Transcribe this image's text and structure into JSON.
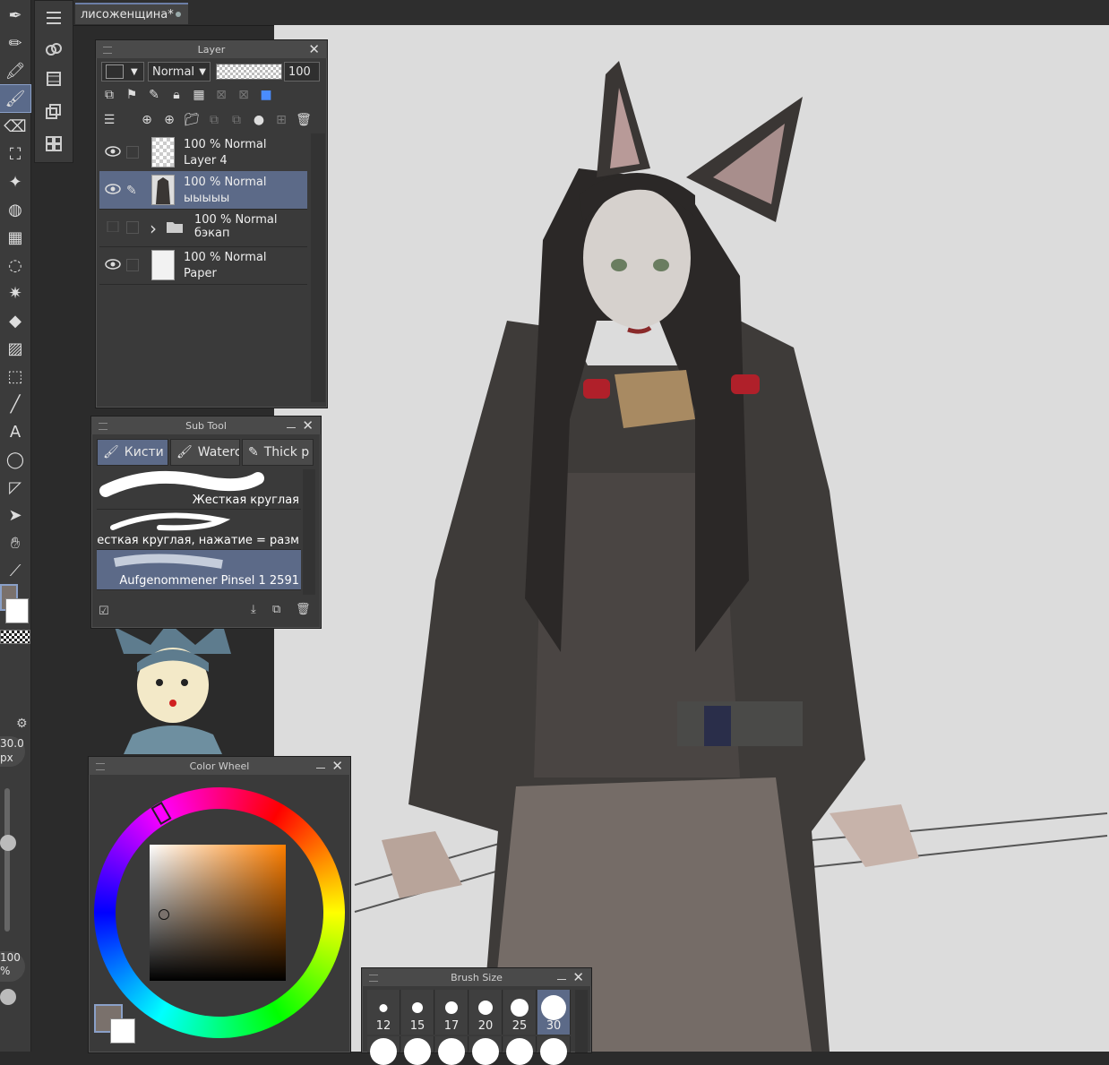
{
  "document": {
    "tab_title": "лисоженщина*"
  },
  "tools": {
    "active_index": 3,
    "size_value": "30.0",
    "size_unit": "px",
    "opacity_value": "100",
    "opacity_unit": "%",
    "icons": [
      "pen-icon",
      "pencil-icon",
      "marker-icon",
      "brush-icon",
      "eraser-icon",
      "stamp-icon",
      "sparkle-icon",
      "blend-icon",
      "mesh-icon",
      "lasso-icon",
      "star-icon",
      "fill-icon",
      "gradient-icon",
      "3d-icon",
      "line-icon",
      "text-icon",
      "select-icon",
      "figure-icon",
      "move-icon",
      "hand-icon",
      "eyedropper-icon"
    ]
  },
  "layer_panel": {
    "title": "Layer",
    "blend_mode": "Normal",
    "opacity": "100",
    "layers": [
      {
        "percent": "100 %",
        "mode": "Normal",
        "name": "Layer 4",
        "visible": true,
        "thumb": "checker"
      },
      {
        "percent": "100 %",
        "mode": "Normal",
        "name": "ыыыыы",
        "visible": true,
        "selected": true,
        "thumb": "figure"
      },
      {
        "percent": "100 %",
        "mode": "Normal",
        "name": "бэкап",
        "visible": false,
        "folder": true
      },
      {
        "percent": "100 %",
        "mode": "Normal",
        "name": "Paper",
        "visible": true,
        "thumb": "paper"
      }
    ]
  },
  "subtool_panel": {
    "title": "Sub Tool",
    "tabs": [
      "Кисти",
      "Waterc",
      "Thick p"
    ],
    "brushes": [
      "Жесткая круглая",
      "Жесткая круглая, нажатие = разм",
      "Aufgenommener Pinsel 1 2591"
    ]
  },
  "colorwheel_panel": {
    "title": "Color Wheel",
    "main_color": "#7a716c",
    "sub_color": "#ffffff"
  },
  "brushsize_panel": {
    "title": "Brush Size",
    "sizes": [
      "12",
      "15",
      "17",
      "20",
      "25",
      "30"
    ],
    "selected": "30"
  },
  "colors": {
    "accent": "#5c6a88",
    "canvas": "#dcdcdc",
    "ui_bg": "#3a3a3a"
  }
}
